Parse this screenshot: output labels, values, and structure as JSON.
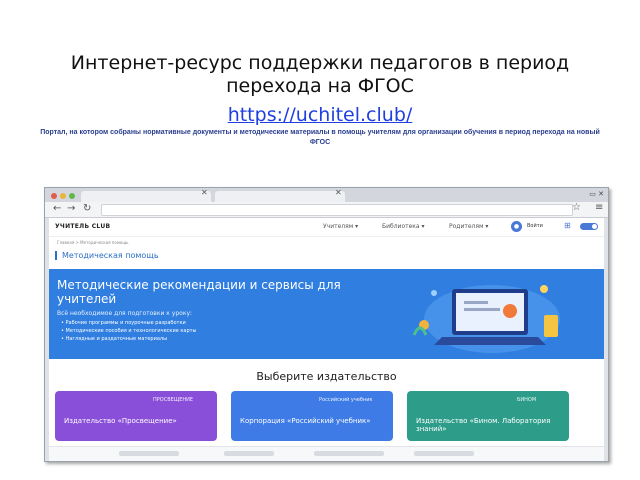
{
  "slide": {
    "title": "Интернет-ресурс поддержки педагогов в период перехода на ФГОС",
    "link": "https://uchitel.club/",
    "subtitle": "Портал, на котором собраны нормативные документы и методические материалы в помощь учителям для организации обучения в период перехода на новый ФГОС"
  },
  "browser": {
    "tabs": [
      "",
      ""
    ],
    "nav_icons": [
      "back-icon",
      "forward-icon",
      "reload-icon"
    ],
    "url": ""
  },
  "site": {
    "logo": "УЧИТЕЛЬ CLUB",
    "nav": [
      "Учителям ▾",
      "Библиотека ▾",
      "Родителям ▾"
    ],
    "login": "Войти",
    "breadcrumb": "Главная > Методическая помощь",
    "section_title": "Методическая помощь",
    "hero": {
      "title": "Методические рекомендации и сервисы для учителей",
      "subtitle": "Всё необходимое для подготовки к уроку:",
      "items": [
        "Рабочие программы и поурочные разработки",
        "Методические пособия и технологические карты",
        "Наглядные и раздаточные материалы"
      ]
    },
    "publishers_title": "Выберите издательство",
    "publishers": [
      {
        "name": "Издательство «Просвещение»",
        "logo": "ПРОСВЕЩЕНИЕ",
        "color": "#8a4fd8"
      },
      {
        "name": "Корпорация «Российский учебник»",
        "logo": "Российский учебник",
        "color": "#3f7be6"
      },
      {
        "name": "Издательство «Бином. Лаборатория знаний»",
        "logo": "БИНОМ",
        "color": "#2d9d8a"
      }
    ]
  },
  "colors": {
    "hero": "#2f7ee0",
    "accent": "#2d6fc4",
    "link": "#1f3fe0"
  }
}
